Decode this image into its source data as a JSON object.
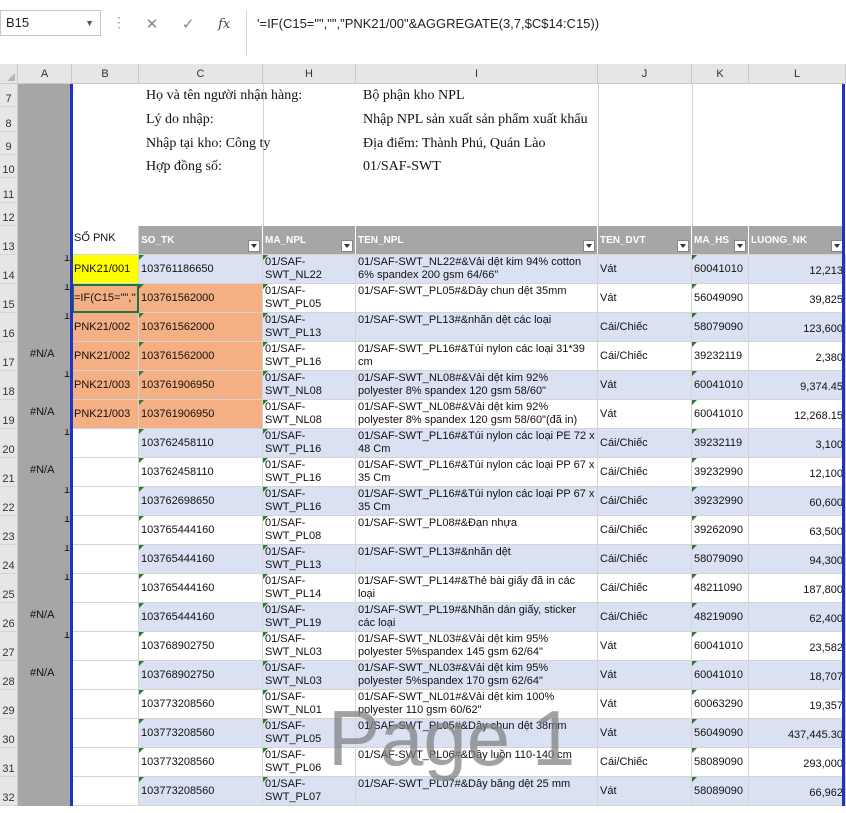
{
  "name_box": "B15",
  "formula": "'=IF(C15=\"\",\"\",\"PNK21/00\"&AGGREGATE(3,7,$C$14:C15))",
  "formula_icons": [
    "cancel-icon",
    "enter-check-icon",
    "function-icon"
  ],
  "watermark": "Page 1",
  "colors": {
    "header_gray": "#a6a6a6",
    "yellow": "#ffff00",
    "orange": "#f4b084",
    "band_blue": "#d9e1f2",
    "gray_col": "#a6a6a6",
    "page_break_blue": "#1c33c5"
  },
  "column_headers": [
    "A",
    "B",
    "C",
    "H",
    "I",
    "J",
    "K",
    "L"
  ],
  "row_numbers": [
    "7",
    "8",
    "9",
    "10",
    "11",
    "12",
    "13",
    "14",
    "15",
    "16",
    "17",
    "18",
    "19",
    "20",
    "21",
    "22",
    "23",
    "24",
    "25",
    "26",
    "27",
    "28",
    "29",
    "30",
    "31",
    "32"
  ],
  "info": {
    "r7c": "Họ và tên người nhận hàng:",
    "r7i": "Bộ phận kho NPL",
    "r8c": "Lý do nhập:",
    "r8i": "Nhập NPL sản xuất sản phẩm xuất khẩu",
    "r9c": "Nhập tại kho:  Công ty",
    "r9i": "Địa điểm:  Thành Phú, Quán Lào",
    "r10c": "Hợp đồng số:",
    "r10i": "01/SAF-SWT"
  },
  "table_header": {
    "b": "SỐ PNK",
    "c": "SO_TK",
    "h": "MA_NPL",
    "i": "TEN_NPL",
    "j": "TEN_DVT",
    "k": "MA_HS",
    "l": "LUONG_NK"
  },
  "rows": [
    {
      "a": "1",
      "b": "PNK21/001",
      "c": "103761186650",
      "h": "01/SAF-SWT_NL22",
      "i": "01/SAF-SWT_NL22#&Vải dệt kim 94% cotton 6% spandex 200 gsm 64/66\"",
      "j": "Vát",
      "k": "60041010",
      "l": "12,213"
    },
    {
      "a": "1",
      "b": "=IF(C15=\"\",\"\",\"",
      "c": "103761562000",
      "h": "01/SAF-SWT_PL05",
      "i": "01/SAF-SWT_PL05#&Dây chun dệt 35mm",
      "j": "Vát",
      "k": "56049090",
      "l": "39,825"
    },
    {
      "a": "1",
      "b": "PNK21/002",
      "c": "103761562000",
      "h": "01/SAF-SWT_PL13",
      "i": "01/SAF-SWT_PL13#&nhãn dệt các loại",
      "j": "Cái/Chiếc",
      "k": "58079090",
      "l": "123,600"
    },
    {
      "a": "#N/A",
      "b": "PNK21/002",
      "c": "103761562000",
      "h": "01/SAF-SWT_PL16",
      "i": "01/SAF-SWT_PL16#&Túi nylon các loại 31*39 cm",
      "j": "Cái/Chiếc",
      "k": "39232119",
      "l": "2,380"
    },
    {
      "a": "1",
      "b": "PNK21/003",
      "c": "103761906950",
      "h": "01/SAF-SWT_NL08",
      "i": "01/SAF-SWT_NL08#&Vải dệt kim 92% polyester 8% spandex 120 gsm 58/60\"",
      "j": "Vát",
      "k": "60041010",
      "l": "9,374.45"
    },
    {
      "a": "#N/A",
      "b": "PNK21/003",
      "c": "103761906950",
      "h": "01/SAF-SWT_NL08",
      "i": "01/SAF-SWT_NL08#&Vải dệt kim 92% polyester 8% spandex 120 gsm 58/60\"(đã in)",
      "j": "Vát",
      "k": "60041010",
      "l": "12,268.15"
    },
    {
      "a": "1",
      "b": "",
      "c": "103762458110",
      "h": "01/SAF-SWT_PL16",
      "i": "01/SAF-SWT_PL16#&Túi nylon các loại PE 72 x 48 Cm",
      "j": "Cái/Chiếc",
      "k": "39232119",
      "l": "3,100"
    },
    {
      "a": "#N/A",
      "b": "",
      "c": "103762458110",
      "h": "01/SAF-SWT_PL16",
      "i": "01/SAF-SWT_PL16#&Túi nylon các loại PP 67 x 35 Cm",
      "j": "Cái/Chiếc",
      "k": "39232990",
      "l": "12,100"
    },
    {
      "a": "1",
      "b": "",
      "c": "103762698650",
      "h": "01/SAF-SWT_PL16",
      "i": "01/SAF-SWT_PL16#&Túi nylon các loại PP 67 x 35 Cm",
      "j": "Cái/Chiếc",
      "k": "39232990",
      "l": "60,600"
    },
    {
      "a": "1",
      "b": "",
      "c": "103765444160",
      "h": "01/SAF-SWT_PL08",
      "i": "01/SAF-SWT_PL08#&Đạn nhựa",
      "j": "Cái/Chiếc",
      "k": "39262090",
      "l": "63,500"
    },
    {
      "a": "1",
      "b": "",
      "c": "103765444160",
      "h": "01/SAF-SWT_PL13",
      "i": "01/SAF-SWT_PL13#&nhãn dệt",
      "j": "Cái/Chiếc",
      "k": "58079090",
      "l": "94,300"
    },
    {
      "a": "1",
      "b": "",
      "c": "103765444160",
      "h": "01/SAF-SWT_PL14",
      "i": "01/SAF-SWT_PL14#&Thẻ bài giấy đã in các loại",
      "j": "Cái/Chiếc",
      "k": "48211090",
      "l": "187,800"
    },
    {
      "a": "#N/A",
      "b": "",
      "c": "103765444160",
      "h": "01/SAF-SWT_PL19",
      "i": "01/SAF-SWT_PL19#&Nhãn dán giấy, sticker các loại",
      "j": "Cái/Chiếc",
      "k": "48219090",
      "l": "62,400"
    },
    {
      "a": "1",
      "b": "",
      "c": "103768902750",
      "h": "01/SAF-SWT_NL03",
      "i": "01/SAF-SWT_NL03#&Vải dệt kim 95% polyester 5%spandex 145 gsm 62/64\"",
      "j": "Vát",
      "k": "60041010",
      "l": "23,582"
    },
    {
      "a": "#N/A",
      "b": "",
      "c": "103768902750",
      "h": "01/SAF-SWT_NL03",
      "i": "01/SAF-SWT_NL03#&Vải dệt kim 95% polyester 5%spandex 170 gsm 62/64\"",
      "j": "Vát",
      "k": "60041010",
      "l": "18,707"
    },
    {
      "a": "",
      "b": "",
      "c": "103773208560",
      "h": "01/SAF-SWT_NL01",
      "i": "01/SAF-SWT_NL01#&Vải dệt kim 100% polyester 110 gsm 60/62\"",
      "j": "Vát",
      "k": "60063290",
      "l": "19,357"
    },
    {
      "a": "",
      "b": "",
      "c": "103773208560",
      "h": "01/SAF-SWT_PL05",
      "i": "01/SAF-SWT_PL05#&Dây chun dệt 38mm",
      "j": "Vát",
      "k": "56049090",
      "l": "437,445.30"
    },
    {
      "a": "",
      "b": "",
      "c": "103773208560",
      "h": "01/SAF-SWT_PL06",
      "i": "01/SAF-SWT_PL06#&Dây luồn 110-140 cm",
      "j": "Cái/Chiếc",
      "k": "58089090",
      "l": "293,000"
    },
    {
      "a": "",
      "b": "",
      "c": "103773208560",
      "h": "01/SAF-SWT_PL07",
      "i": "01/SAF-SWT_PL07#&Dây băng dệt 25 mm",
      "j": "Vát",
      "k": "58089090",
      "l": "66,962"
    }
  ]
}
